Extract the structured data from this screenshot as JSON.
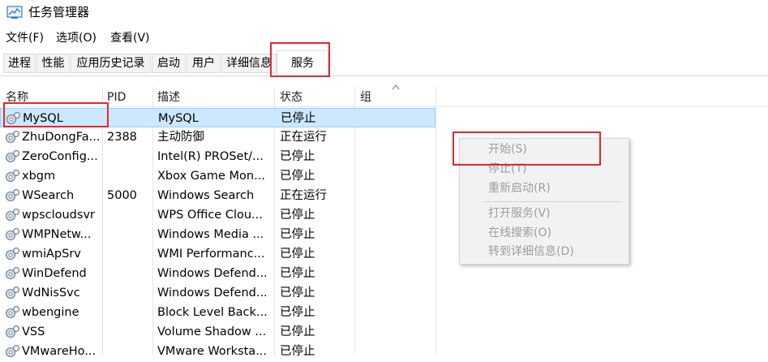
{
  "window": {
    "title": "任务管理器",
    "icon": "task-manager-icon"
  },
  "menu": [
    "文件(F)",
    "选项(O)",
    "查看(V)"
  ],
  "tabs": [
    "进程",
    "性能",
    "应用历史记录",
    "启动",
    "用户",
    "详细信息",
    "服务"
  ],
  "active_tab": "服务",
  "columns": {
    "name": "名称",
    "pid": "PID",
    "desc": "描述",
    "status": "状态",
    "group": "组"
  },
  "rows": [
    {
      "name": "MySQL",
      "pid": "",
      "desc": "MySQL",
      "status": "已停止"
    },
    {
      "name": "ZhuDongFa...",
      "pid": "2388",
      "desc": "主动防御",
      "status": "正在运行"
    },
    {
      "name": "ZeroConfig...",
      "pid": "",
      "desc": "Intel(R) PROSet/...",
      "status": "已停止"
    },
    {
      "name": "xbgm",
      "pid": "",
      "desc": "Xbox Game Mon...",
      "status": "已停止"
    },
    {
      "name": "WSearch",
      "pid": "5000",
      "desc": "Windows Search",
      "status": "正在运行"
    },
    {
      "name": "wpscloudsvr",
      "pid": "",
      "desc": "WPS Office Clou...",
      "status": "已停止"
    },
    {
      "name": "WMPNetw...",
      "pid": "",
      "desc": "Windows Media ...",
      "status": "已停止"
    },
    {
      "name": "wmiApSrv",
      "pid": "",
      "desc": "WMI Performanc...",
      "status": "已停止"
    },
    {
      "name": "WinDefend",
      "pid": "",
      "desc": "Windows Defend...",
      "status": "已停止"
    },
    {
      "name": "WdNisSvc",
      "pid": "",
      "desc": "Windows Defend...",
      "status": "已停止"
    },
    {
      "name": "wbengine",
      "pid": "",
      "desc": "Block Level Back...",
      "status": "已停止"
    },
    {
      "name": "VSS",
      "pid": "",
      "desc": "Volume Shadow ...",
      "status": "已停止"
    },
    {
      "name": "VMwareHo...",
      "pid": "",
      "desc": "VMware Worksta...",
      "status": "已停止"
    }
  ],
  "selected_row": "MySQL",
  "context_menu": {
    "items": [
      "开始(S)",
      "停止(T)",
      "重新启动(R)",
      "打开服务(V)",
      "在线搜索(O)",
      "转到详细信息(D)"
    ]
  },
  "colors": {
    "highlight_box": "#e0282d",
    "selection": "#cce8ff",
    "disabled_text": "#9d9d9d"
  }
}
